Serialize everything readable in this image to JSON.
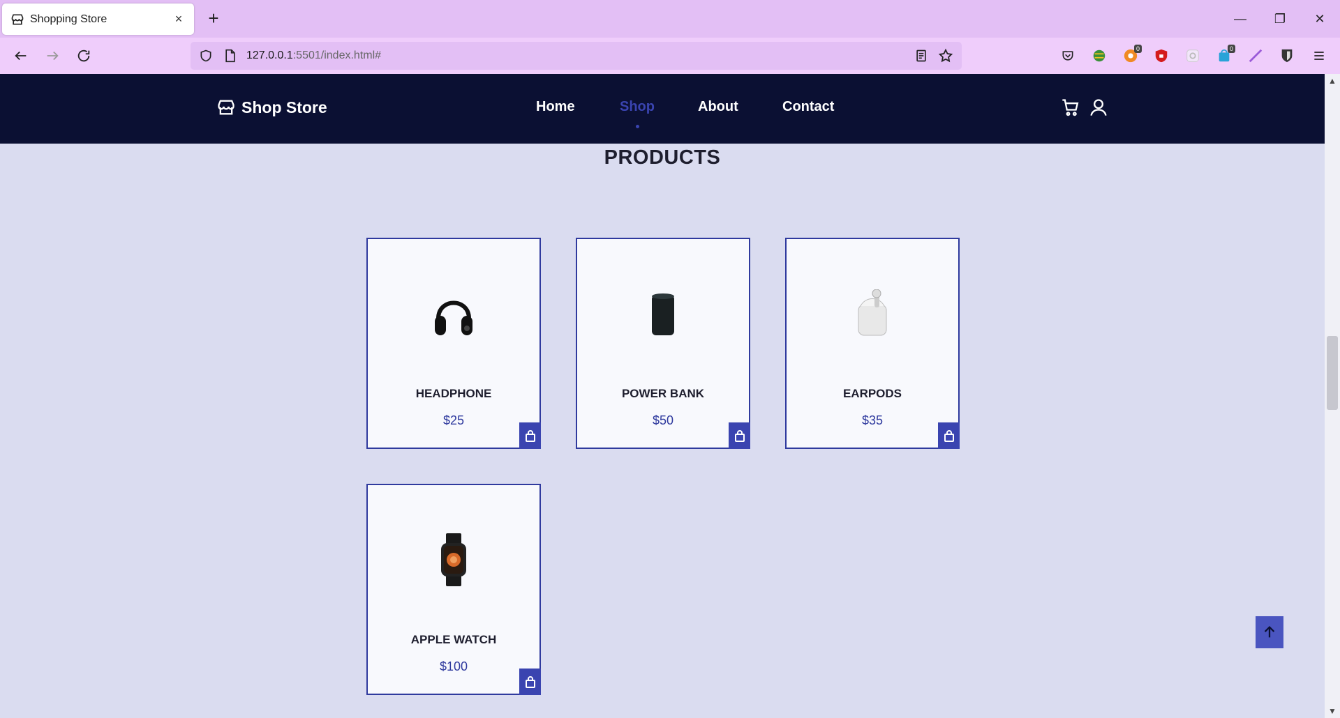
{
  "browser": {
    "tab_title": "Shopping Store",
    "tab_close_glyph": "×",
    "new_tab_glyph": "+",
    "url_host": "127.0.0.1",
    "url_path": ":5501/index.html#",
    "minimize_glyph": "—",
    "restore_glyph": "❐",
    "close_glyph": "✕",
    "extension_badges": [
      "0",
      "0"
    ]
  },
  "site": {
    "brand": "Shop Store",
    "nav": [
      {
        "label": "Home",
        "active": false
      },
      {
        "label": "Shop",
        "active": true
      },
      {
        "label": "About",
        "active": false
      },
      {
        "label": "Contact",
        "active": false
      }
    ],
    "section_title": "PRODUCTS",
    "products": [
      {
        "name": "HEADPHONE",
        "price": "$25",
        "icon": "headphone-image"
      },
      {
        "name": "POWER BANK",
        "price": "$50",
        "icon": "power-bank-image"
      },
      {
        "name": "EARPODS",
        "price": "$35",
        "icon": "earpods-image"
      },
      {
        "name": "APPLE WATCH",
        "price": "$100",
        "icon": "apple-watch-image"
      }
    ]
  },
  "colors": {
    "header_bg": "#0b1033",
    "accent": "#3a44b0",
    "page_bg": "#dadcf0",
    "tabbar_bg": "#e3bff5"
  }
}
